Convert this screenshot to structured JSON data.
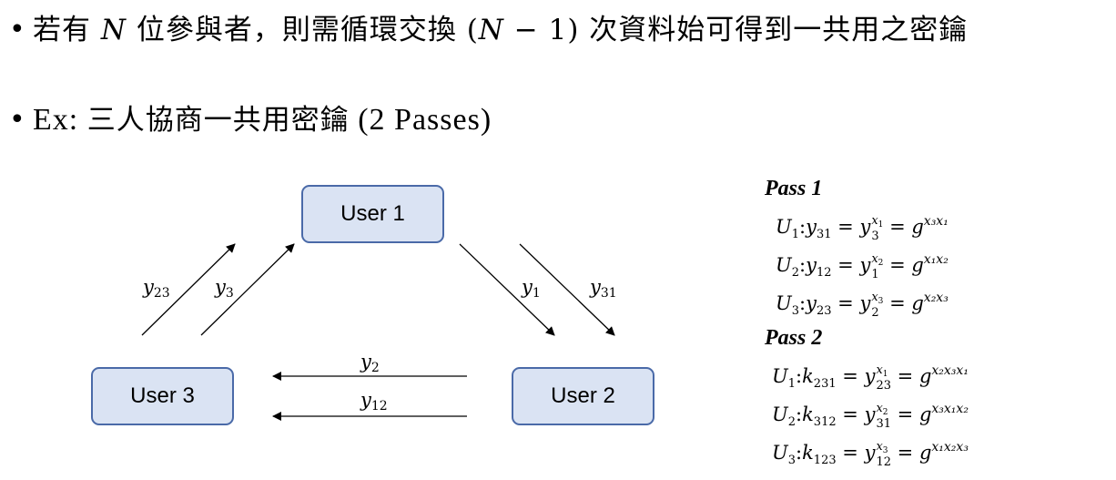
{
  "bullets": [
    {
      "text_a": "若有 ",
      "math": "N",
      "text_b": " 位參與者，則需循環交換 (",
      "math2": "N",
      "text_c": " − 1) 次資料始可得到一共用之密鑰"
    },
    {
      "prefix": "Ex: ",
      "text": "三人協商一共用密鑰",
      "suffix": " (2 Passes)"
    }
  ],
  "diagram": {
    "users": {
      "u1": "User 1",
      "u2": "User 2",
      "u3": "User 3"
    },
    "labels": [
      {
        "base": "y",
        "sub": "23"
      },
      {
        "base": "y",
        "sub": "3"
      },
      {
        "base": "y",
        "sub": "1"
      },
      {
        "base": "y",
        "sub": "31"
      },
      {
        "base": "y",
        "sub": "2"
      },
      {
        "base": "y",
        "sub": "12"
      }
    ]
  },
  "pass1": {
    "title": "Pass 1",
    "equations": [
      {
        "user": "U",
        "user_sub": "1",
        "lhs": "y",
        "lhs_sub": "31",
        "y_sub": "3",
        "y_exp": "x",
        "y_exp_sub": "1",
        "rhs_exp": "x₃x₁"
      },
      {
        "user": "U",
        "user_sub": "2",
        "lhs": "y",
        "lhs_sub": "12",
        "y_sub": "1",
        "y_exp": "x",
        "y_exp_sub": "2",
        "rhs_exp": "x₁x₂"
      },
      {
        "user": "U",
        "user_sub": "3",
        "lhs": "y",
        "lhs_sub": "23",
        "y_sub": "2",
        "y_exp": "x",
        "y_exp_sub": "3",
        "rhs_exp": "x₂x₃"
      }
    ]
  },
  "pass2": {
    "title": "Pass 2",
    "equations": [
      {
        "user": "U",
        "user_sub": "1",
        "lhs": "k",
        "lhs_sub": "231",
        "y_sub": "23",
        "y_exp": "x",
        "y_exp_sub": "1",
        "rhs_exp": "x₂x₃x₁"
      },
      {
        "user": "U",
        "user_sub": "2",
        "lhs": "k",
        "lhs_sub": "312",
        "y_sub": "31",
        "y_exp": "x",
        "y_exp_sub": "2",
        "rhs_exp": "x₃x₁x₂"
      },
      {
        "user": "U",
        "user_sub": "3",
        "lhs": "k",
        "lhs_sub": "123",
        "y_sub": "12",
        "y_exp": "x",
        "y_exp_sub": "3",
        "rhs_exp": "x₁x₂x₃"
      }
    ]
  },
  "symbols": {
    "y": "y",
    "g": "g",
    "equals": "=",
    "colon": ":"
  },
  "colors": {
    "box_fill": "#dae3f3",
    "box_border": "#4a6aa8"
  }
}
